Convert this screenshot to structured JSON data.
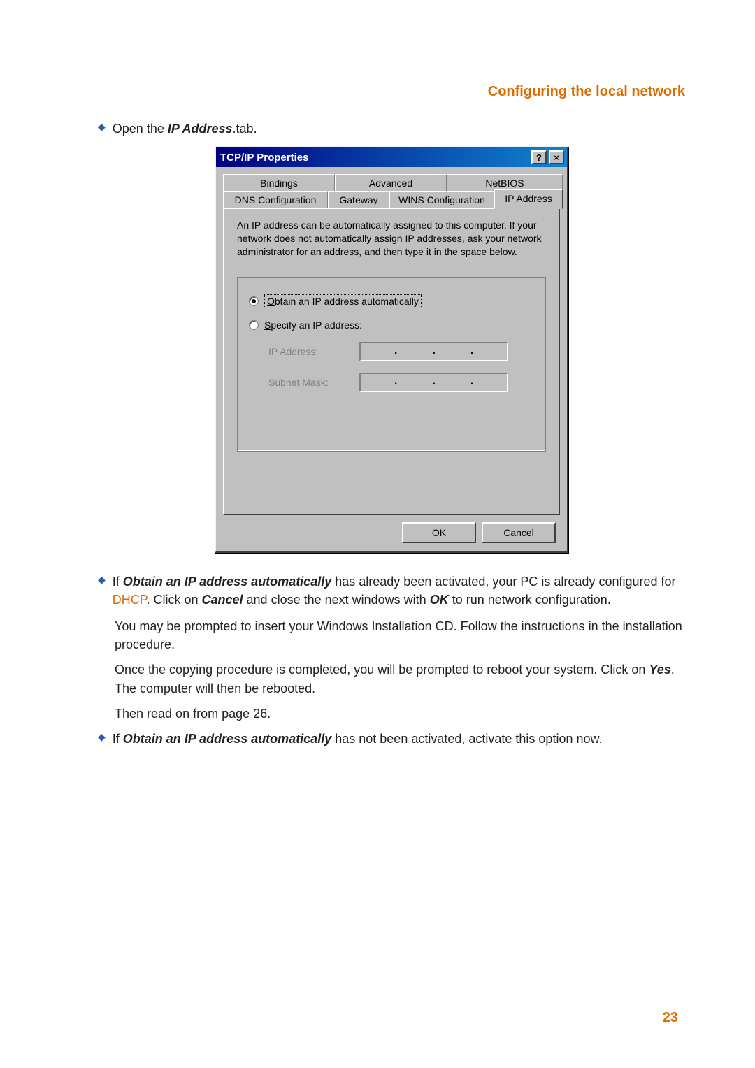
{
  "header": {
    "title": "Configuring the local network"
  },
  "intro": {
    "bullet": "◆",
    "open_the": "Open the ",
    "ip_address": "IP Address",
    "tab_suffix": ".tab."
  },
  "dialog": {
    "title": "TCP/IP Properties",
    "help_btn": "?",
    "close_btn": "×",
    "tabs": {
      "bindings": "Bindings",
      "advanced": "Advanced",
      "netbios": "NetBIOS",
      "dns": "DNS Configuration",
      "gateway": "Gateway",
      "wins": "WINS Configuration",
      "ip": "IP Address"
    },
    "desc": "An IP address can be automatically assigned to this computer. If your network does not automatically assign IP addresses, ask your network administrator for an address, and then type it in the space below.",
    "radio_obtain": "Obtain an IP address automatically",
    "radio_specify": "Specify an IP address:",
    "ip_label": "IP Address:",
    "subnet_label": "Subnet Mask:",
    "ok": "OK",
    "cancel": "Cancel"
  },
  "para1": {
    "bullet": "◆",
    "t1": "If ",
    "b1": "Obtain an IP address automatically",
    "t2": " has already been activated, your PC is already configured for ",
    "dhcp": "DHCP",
    "t3": ". Click on ",
    "b2": "Cancel",
    "t4": " and close the next windows with ",
    "b3": "OK",
    "t5": " to run network configuration."
  },
  "para2": "You may be prompted to insert your Windows Installation CD. Follow the instructions in the installation procedure.",
  "para3": {
    "t1": "Once the copying procedure is completed, you will be prompted to reboot your system. Click on ",
    "yes": "Yes",
    "t2": ". The computer will then be rebooted."
  },
  "para4": "Then read on from page 26.",
  "para5": {
    "bullet": "◆",
    "t1": "If ",
    "b1": "Obtain an IP address automatically",
    "t2": " has not been activated, activate this option now."
  },
  "page_number": "23"
}
